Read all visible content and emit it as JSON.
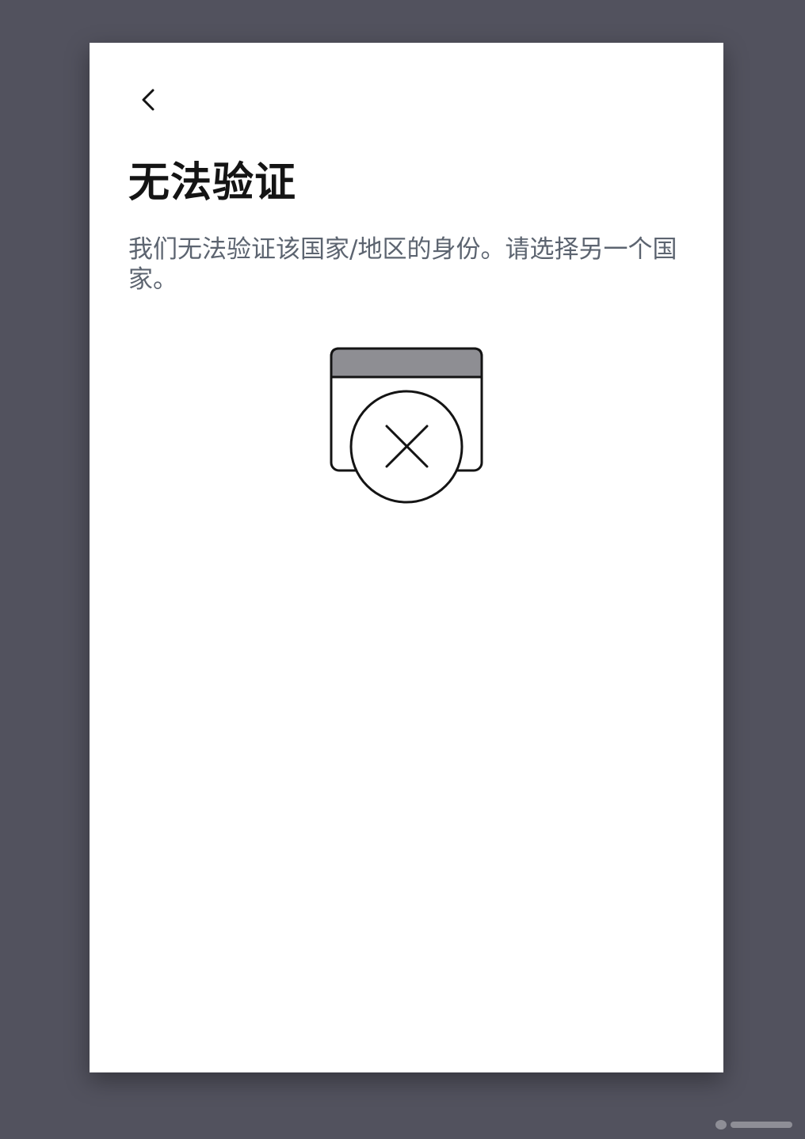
{
  "screen": {
    "title": "无法验证",
    "message": "我们无法验证该国家/地区的身份。请选择另一个国家。"
  },
  "icons": {
    "back": "chevron-left-icon",
    "illustration": "document-error-icon"
  },
  "colors": {
    "background": "#52525e",
    "card": "#ffffff",
    "title": "#141414",
    "message": "#5c6470",
    "illustration_header": "#8e8e93",
    "stroke": "#141414"
  }
}
